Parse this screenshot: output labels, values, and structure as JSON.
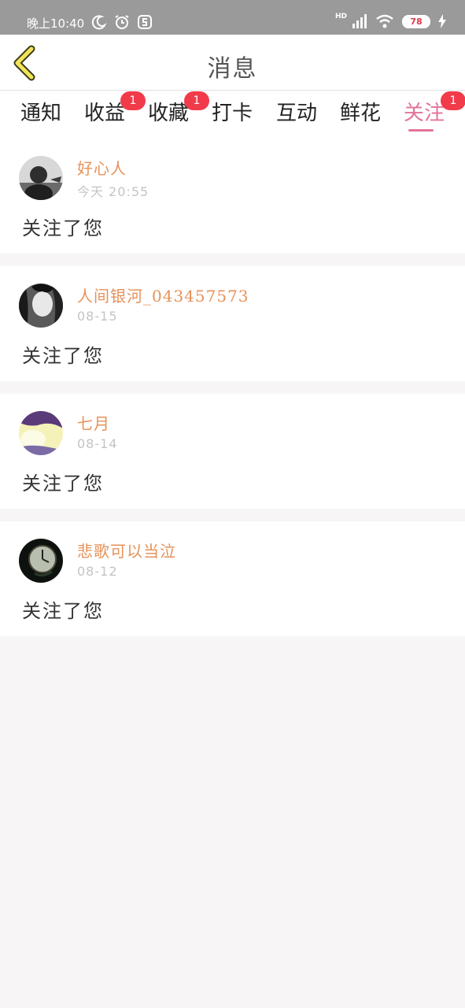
{
  "status_bar": {
    "time": "晚上10:40",
    "network": "HD",
    "battery": "78"
  },
  "header": {
    "title": "消息"
  },
  "tabs": [
    {
      "label": "通知",
      "badge": ""
    },
    {
      "label": "收益",
      "badge": "1"
    },
    {
      "label": "收藏",
      "badge": "1"
    },
    {
      "label": "打卡",
      "badge": ""
    },
    {
      "label": "互动",
      "badge": ""
    },
    {
      "label": "鲜花",
      "badge": ""
    },
    {
      "label": "关注",
      "badge": "1",
      "active": true
    }
  ],
  "messages": [
    {
      "username": "好心人",
      "time": "今天 20:55",
      "text": "关注了您",
      "avatar": "avatar-bw-man"
    },
    {
      "username": "人间银河_043457573",
      "time": "08-15",
      "text": "关注了您",
      "avatar": "avatar-bw-woman"
    },
    {
      "username": "七月",
      "time": "08-14",
      "text": "关注了您",
      "avatar": "avatar-colorful"
    },
    {
      "username": "悲歌可以当泣",
      "time": "08-12",
      "text": "关注了您",
      "avatar": "avatar-pocket-watch"
    }
  ],
  "colors": {
    "accent": "#e2739a",
    "username": "#e6925a",
    "badge": "#f23b4a",
    "back_arrow": "#f2e55a"
  }
}
